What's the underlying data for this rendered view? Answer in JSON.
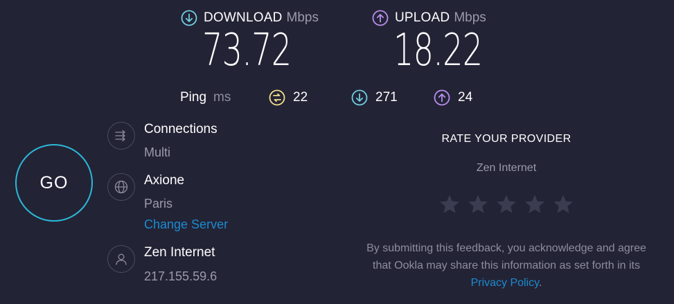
{
  "download": {
    "label": "DOWNLOAD",
    "unit": "Mbps",
    "value": "73.72",
    "icon": "arrow-down-circle-icon",
    "color": "#6fd0e0"
  },
  "upload": {
    "label": "UPLOAD",
    "unit": "Mbps",
    "value": "18.22",
    "icon": "arrow-up-circle-icon",
    "color": "#b890ee"
  },
  "ping": {
    "label": "Ping",
    "unit": "ms",
    "idle": "22",
    "download": "271",
    "upload": "24",
    "idle_color": "#f3e08a"
  },
  "go_button": {
    "label": "GO",
    "color": "#2bb9d8"
  },
  "connections": {
    "title": "Connections",
    "value": "Multi",
    "icon": "connections-icon"
  },
  "server": {
    "title": "Axione",
    "location": "Paris",
    "change_link": "Change Server",
    "icon": "globe-icon"
  },
  "provider": {
    "title": "Zen Internet",
    "ip": "217.155.59.6",
    "icon": "user-icon"
  },
  "rate": {
    "title": "RATE YOUR PROVIDER",
    "provider_name": "Zen Internet",
    "stars_total": 5,
    "stars_selected": 0,
    "disclaimer_before": "By submitting this feedback, you acknowledge and agree that Ookla may share this information as set forth in its ",
    "privacy_link": "Privacy Policy",
    "disclaimer_after": "."
  }
}
